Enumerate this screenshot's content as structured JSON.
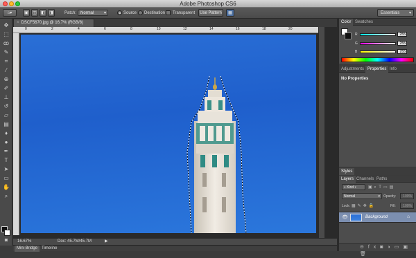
{
  "app": {
    "title": "Adobe Photoshop CS6"
  },
  "options_bar": {
    "patch_label": "Patch:",
    "patch_mode": "Normal",
    "source_label": "Source",
    "destination_label": "Destination",
    "transparent_label": "Transparent",
    "use_pattern_label": "Use Pattern",
    "workspace": "Essentials",
    "source_selected": true
  },
  "document": {
    "tab_title": "DSCF5670.jpg @ 16.7% (RGB/8)",
    "ruler_marks": [
      "0",
      "2",
      "4",
      "6",
      "8",
      "10",
      "12",
      "14",
      "16",
      "18",
      "20"
    ],
    "zoom": "16.67%",
    "doc_size": "Doc: 45.7M/45.7M"
  },
  "bottom_tabs": [
    {
      "label": "Mini Bridge",
      "active": true
    },
    {
      "label": "Timeline",
      "active": false
    }
  ],
  "color_panel": {
    "tabs": [
      {
        "label": "Color",
        "active": true
      },
      {
        "label": "Swatches",
        "active": false
      }
    ],
    "channels": [
      {
        "label": "R",
        "value": "255",
        "gradient": "#00ffff,#ffffff"
      },
      {
        "label": "G",
        "value": "255",
        "gradient": "#ff00ff,#ffffff"
      },
      {
        "label": "B",
        "value": "255",
        "gradient": "#ffff00,#ffffff"
      }
    ]
  },
  "properties_panel": {
    "tabs": [
      {
        "label": "Adjustments",
        "active": false
      },
      {
        "label": "Properties",
        "active": true
      },
      {
        "label": "Info",
        "active": false
      }
    ],
    "message": "No Properties"
  },
  "styles_panel": {
    "tab": "Styles"
  },
  "layers_panel": {
    "tabs": [
      {
        "label": "Layers",
        "active": true
      },
      {
        "label": "Channels",
        "active": false
      },
      {
        "label": "Paths",
        "active": false
      }
    ],
    "filter_kind": "Kind",
    "blend_mode": "Normal",
    "opacity_label": "Opacity:",
    "opacity_value": "100%",
    "lock_label": "Lock:",
    "fill_label": "Fill:",
    "fill_value": "100%",
    "layers": [
      {
        "name": "Background"
      }
    ]
  },
  "colors": {
    "accent": "#2a6fd6",
    "panel": "#4d4d4d"
  }
}
